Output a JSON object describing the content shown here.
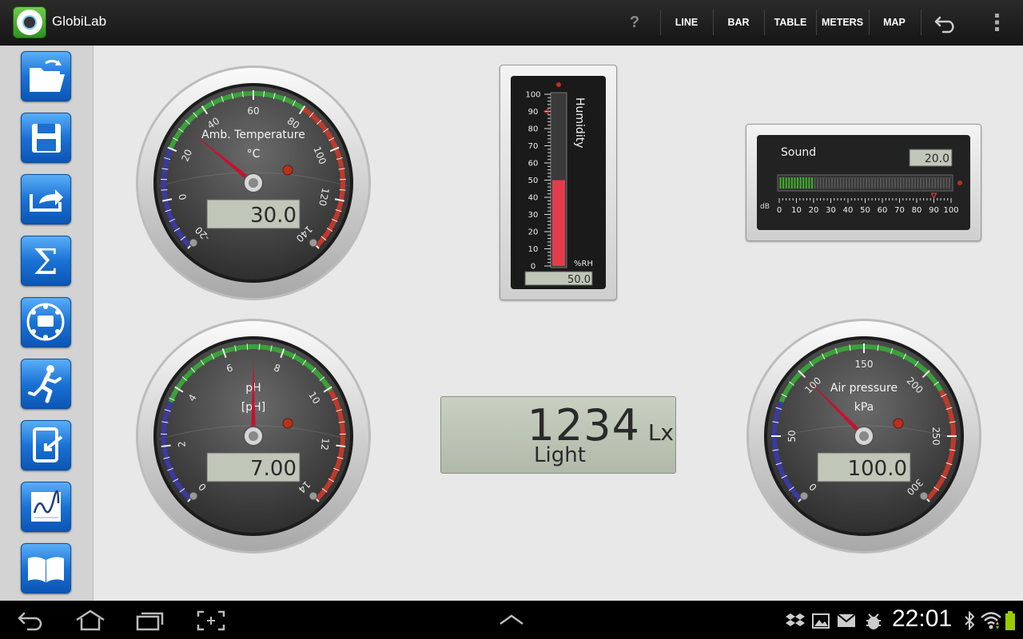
{
  "app": {
    "title": "GlobiLab"
  },
  "actionbar": {
    "help_label": "?",
    "items": [
      "LINE",
      "BAR",
      "TABLE",
      "METERS",
      "MAP"
    ]
  },
  "sidebar": {
    "items": [
      "folder-open-icon",
      "save-icon",
      "export-icon",
      "sigma-icon",
      "sensor-icon",
      "run-icon",
      "import-icon",
      "graph-icon",
      "book-icon"
    ]
  },
  "gauges": {
    "temperature": {
      "title": "Amb. Temperature",
      "unit": "°C",
      "value": "30.0",
      "value_num": 30,
      "min": -20,
      "max": 140,
      "ticks": [
        "-20",
        "0",
        "20",
        "40",
        "60",
        "80",
        "100",
        "120",
        "140"
      ]
    },
    "ph": {
      "title": "pH",
      "unit": "[pH]",
      "value": "7.00",
      "value_num": 7,
      "min": 0,
      "max": 14,
      "ticks": [
        "0",
        "2",
        "4",
        "6",
        "8",
        "10",
        "12",
        "14"
      ]
    },
    "pressure": {
      "title": "Air pressure",
      "unit": "kPa",
      "value": "100.0",
      "value_num": 100,
      "min": 0,
      "max": 300,
      "ticks": [
        "0",
        "50",
        "100",
        "150",
        "200",
        "250",
        "300"
      ]
    }
  },
  "humidity": {
    "title": "Humidity",
    "unit": "%RH",
    "value": "50.0",
    "value_num": 50,
    "alarm": 90,
    "ticks": [
      "100",
      "90",
      "80",
      "70",
      "60",
      "50",
      "40",
      "30",
      "20",
      "10",
      "0"
    ]
  },
  "sound": {
    "title": "Sound",
    "value": "20.0",
    "value_num": 20,
    "alarm": 90,
    "unit": "dB",
    "ticks": [
      "0",
      "10",
      "20",
      "30",
      "40",
      "50",
      "60",
      "70",
      "80",
      "90",
      "100"
    ]
  },
  "light": {
    "value": "1234",
    "unit": "Lx",
    "label": "Light"
  },
  "navbar": {
    "time": "22:01",
    "icons": [
      "back-icon",
      "home-icon",
      "recent-apps-icon",
      "screenshot-icon",
      "up-arrow-icon",
      "dropbox-icon",
      "gallery-icon",
      "gmail-icon",
      "usb-debug-icon",
      "bluetooth-icon",
      "wifi-icon",
      "battery-icon"
    ]
  },
  "colors": {
    "actionbar_bg": "#1b1b1b",
    "sidebar_button": "#1a72d6",
    "gauge_green": "#3aa13a",
    "gauge_red": "#c0392b",
    "gauge_blue": "#3a3aa0",
    "needle": "#c8102e",
    "lcd": "#c0c7b9"
  }
}
